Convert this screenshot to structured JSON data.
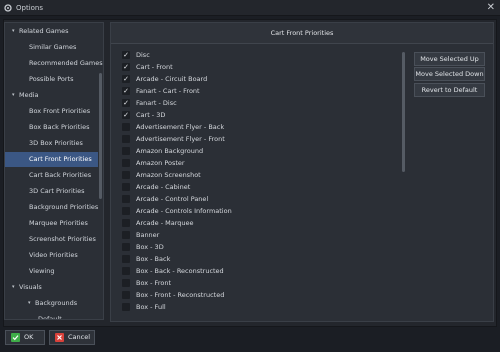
{
  "window": {
    "title": "Options",
    "close_glyph": "✕",
    "icon": "gear-icon"
  },
  "sidebar": {
    "items": [
      {
        "label": "Related Games",
        "level": 0,
        "expanded": true,
        "selected": false
      },
      {
        "label": "Similar Games",
        "level": 1,
        "selected": false
      },
      {
        "label": "Recommended Games",
        "level": 1,
        "selected": false
      },
      {
        "label": "Possible Ports",
        "level": 1,
        "selected": false
      },
      {
        "label": "Media",
        "level": 0,
        "expanded": true,
        "selected": false
      },
      {
        "label": "Box Front Priorities",
        "level": 1,
        "selected": false
      },
      {
        "label": "Box Back Priorities",
        "level": 1,
        "selected": false
      },
      {
        "label": "3D Box Priorities",
        "level": 1,
        "selected": false
      },
      {
        "label": "Cart Front Priorities",
        "level": 1,
        "selected": true
      },
      {
        "label": "Cart Back Priorities",
        "level": 1,
        "selected": false
      },
      {
        "label": "3D Cart Priorities",
        "level": 1,
        "selected": false
      },
      {
        "label": "Background Priorities",
        "level": 1,
        "selected": false
      },
      {
        "label": "Marquee Priorities",
        "level": 1,
        "selected": false
      },
      {
        "label": "Screenshot Priorities",
        "level": 1,
        "selected": false
      },
      {
        "label": "Video Priorities",
        "level": 1,
        "selected": false
      },
      {
        "label": "Viewing",
        "level": 1,
        "selected": false
      },
      {
        "label": "Visuals",
        "level": 0,
        "expanded": true,
        "selected": false
      },
      {
        "label": "Backgrounds",
        "level": 1,
        "expanded": true,
        "selected": false
      },
      {
        "label": "Default",
        "level": 2,
        "selected": false
      }
    ]
  },
  "main": {
    "header": "Cart Front Priorities",
    "list": [
      {
        "label": "Disc",
        "checked": true
      },
      {
        "label": "Cart - Front",
        "checked": true
      },
      {
        "label": "Arcade - Circuit Board",
        "checked": true
      },
      {
        "label": "Fanart - Cart - Front",
        "checked": true
      },
      {
        "label": "Fanart - Disc",
        "checked": true
      },
      {
        "label": "Cart - 3D",
        "checked": true
      },
      {
        "label": "Advertisement Flyer - Back",
        "checked": false
      },
      {
        "label": "Advertisement Flyer - Front",
        "checked": false
      },
      {
        "label": "Amazon Background",
        "checked": false
      },
      {
        "label": "Amazon Poster",
        "checked": false
      },
      {
        "label": "Amazon Screenshot",
        "checked": false
      },
      {
        "label": "Arcade - Cabinet",
        "checked": false
      },
      {
        "label": "Arcade - Control Panel",
        "checked": false
      },
      {
        "label": "Arcade - Controls Information",
        "checked": false
      },
      {
        "label": "Arcade - Marquee",
        "checked": false
      },
      {
        "label": "Banner",
        "checked": false
      },
      {
        "label": "Box - 3D",
        "checked": false
      },
      {
        "label": "Box - Back",
        "checked": false
      },
      {
        "label": "Box - Back - Reconstructed",
        "checked": false
      },
      {
        "label": "Box - Front",
        "checked": false
      },
      {
        "label": "Box - Front - Reconstructed",
        "checked": false
      },
      {
        "label": "Box - Full",
        "checked": false
      }
    ],
    "buttons": {
      "move_up": "Move Selected Up",
      "move_down": "Move Selected Down",
      "revert": "Revert to Default"
    }
  },
  "footer": {
    "ok": "OK",
    "cancel": "Cancel"
  },
  "colors": {
    "ok_icon": "#3fae49",
    "cancel_icon": "#d9413a",
    "selection": "#3b5784"
  }
}
